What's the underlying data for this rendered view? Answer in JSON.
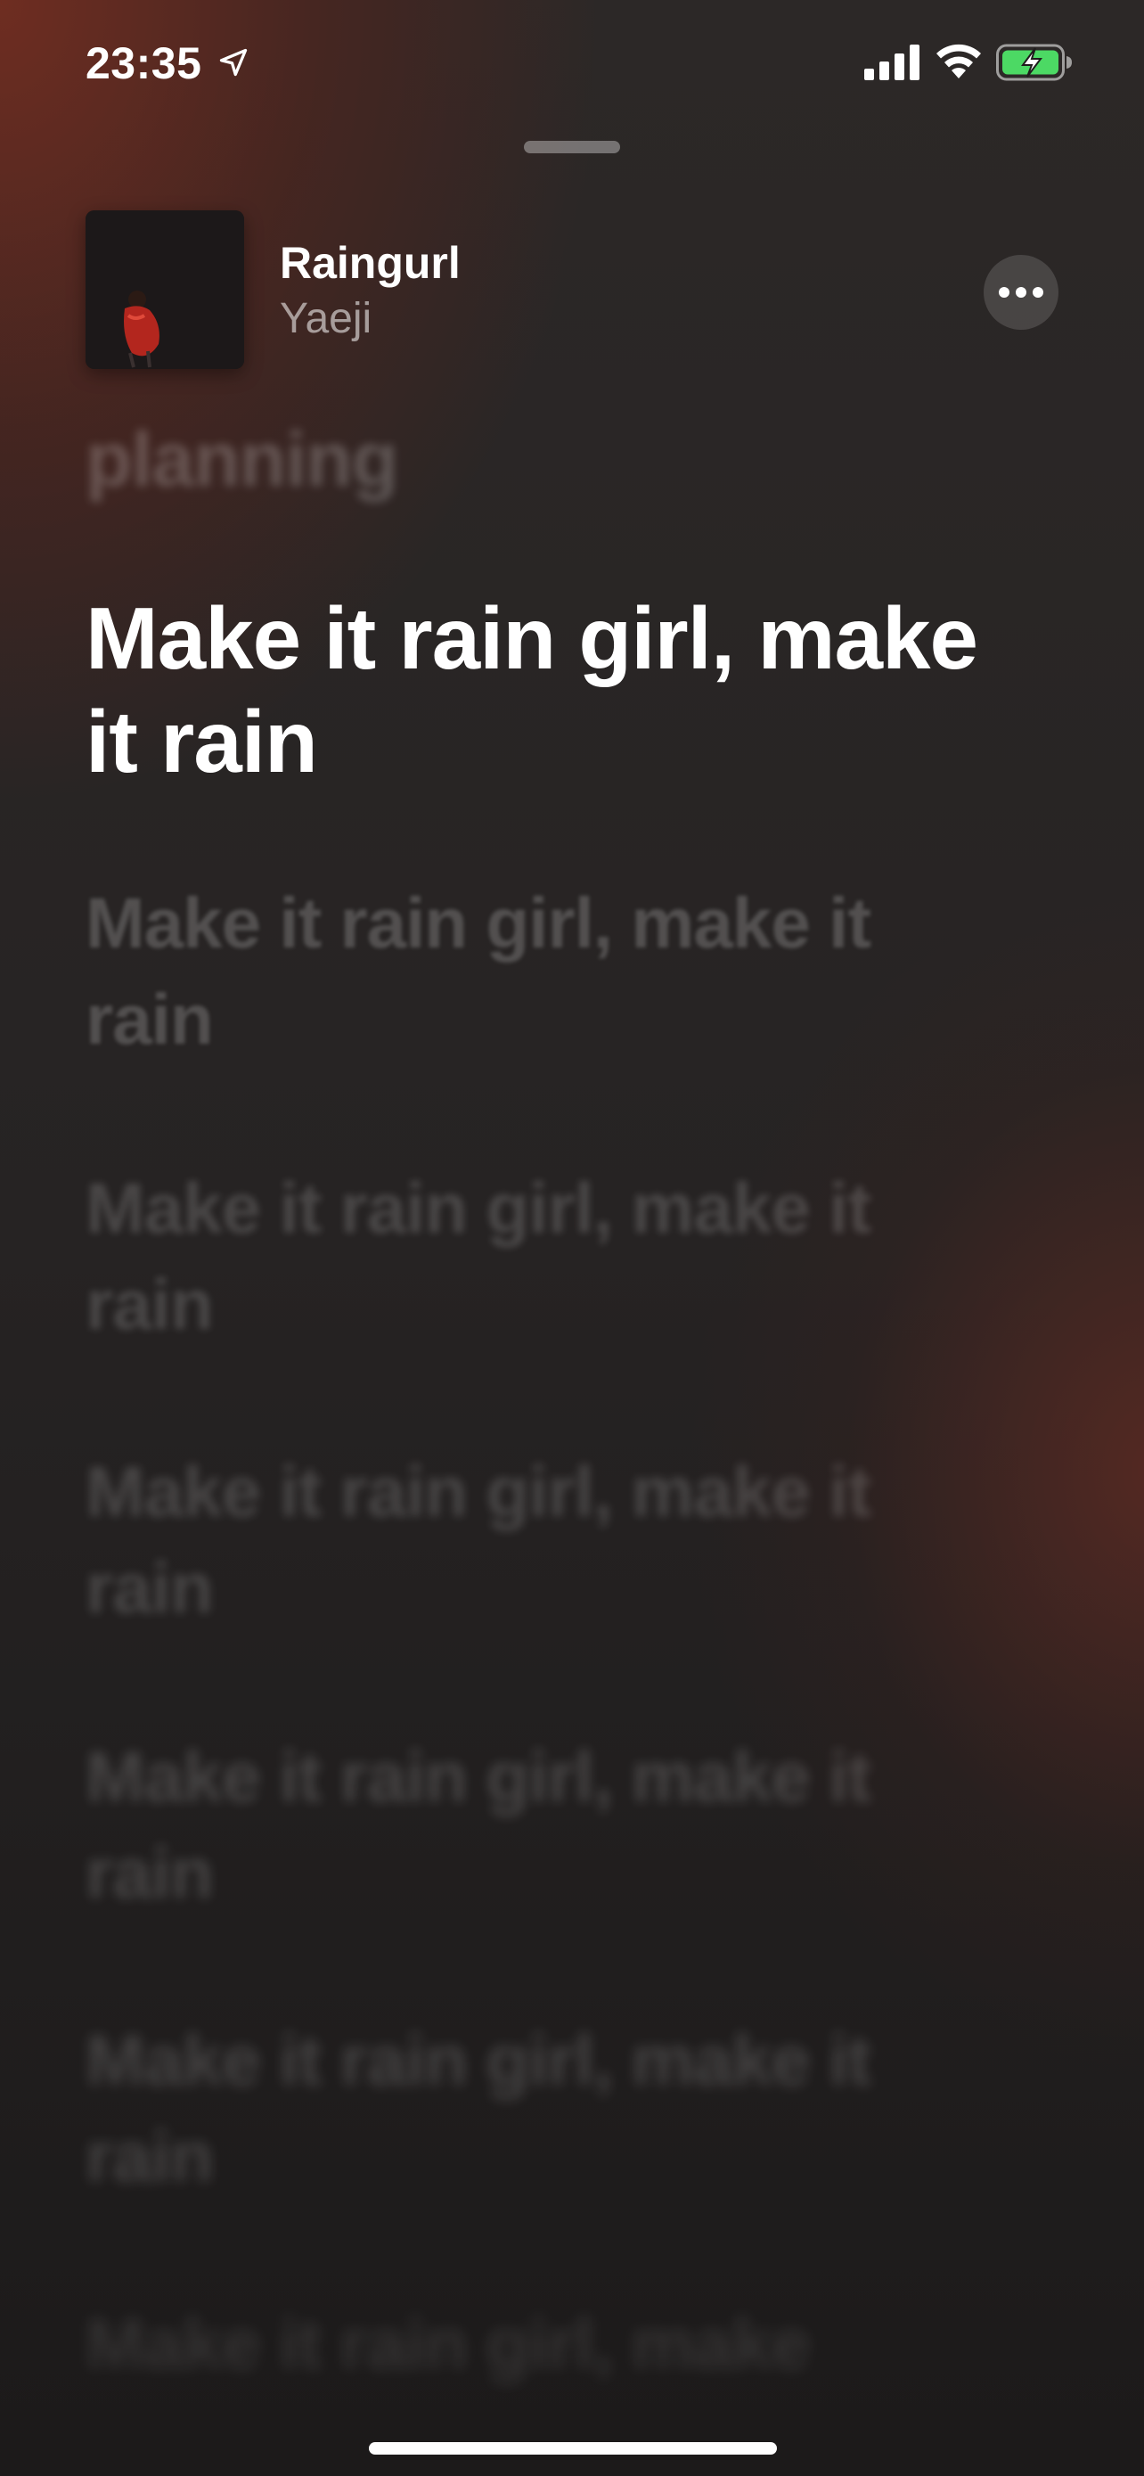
{
  "status_bar": {
    "time": "23:35",
    "icons": [
      "location-arrow-icon",
      "cellular-signal-icon",
      "wifi-icon",
      "battery-charging-icon"
    ],
    "battery_color": "#4cd964"
  },
  "now_playing": {
    "title": "Raingurl",
    "artist": "Yaeji",
    "more_icon": "ellipsis-icon"
  },
  "lyrics": {
    "previous": "planning",
    "current": "Make it rain girl, make it rain",
    "upcoming": [
      "Make it rain girl, make it rain",
      "Make it rain girl, make it rain",
      "Make it rain girl, make it rain",
      "Make it rain girl, make it rain",
      "Make it rain girl, make it rain",
      "Make it rain girl, make"
    ]
  },
  "colors": {
    "accent_background": "#7a2e20",
    "text_primary": "#ffffff"
  }
}
